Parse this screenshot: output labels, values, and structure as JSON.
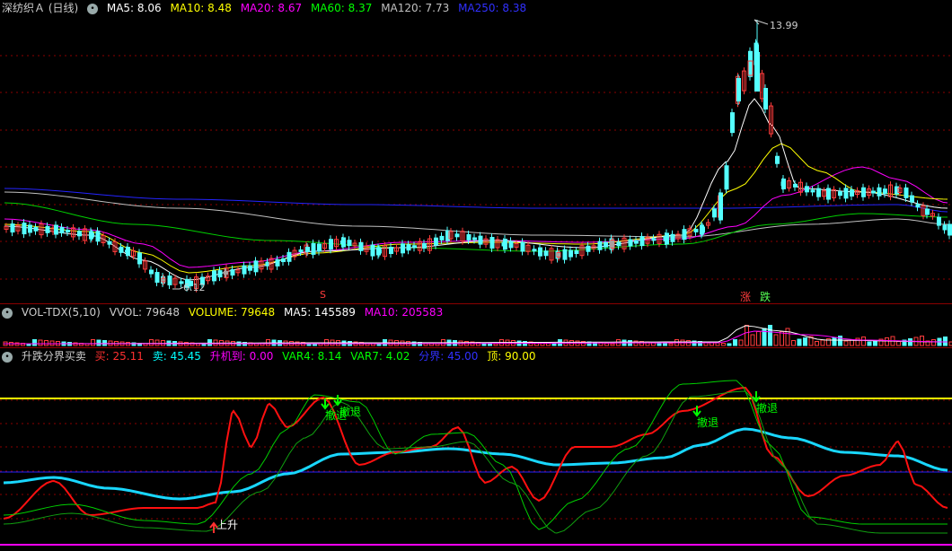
{
  "main_chart": {
    "title": "深纺织Ａ (日线)",
    "indicators": [
      {
        "label": "MA5: 8.06",
        "color": "#ffffff"
      },
      {
        "label": "MA10: 8.48",
        "color": "#ffff00"
      },
      {
        "label": "MA20: 8.67",
        "color": "#ff00ff"
      },
      {
        "label": "MA60: 8.37",
        "color": "#00ff00"
      },
      {
        "label": "MA120: 7.73",
        "color": "#c0c0c0"
      },
      {
        "label": "MA250: 8.38",
        "color": "#0000ff"
      }
    ],
    "high_label": "13.99",
    "low_label": "6.12",
    "markers": {
      "s": "S",
      "up": "涨",
      "down": "跌"
    }
  },
  "volume_chart": {
    "title": "VOL-TDX(5,10)",
    "indicators": [
      {
        "label": "VVOL: 79648",
        "color": "#cccccc"
      },
      {
        "label": "VOLUME: 79648",
        "color": "#ffff00"
      },
      {
        "label": "MA5: 145589",
        "color": "#ffffff"
      },
      {
        "label": "MA10: 205583",
        "color": "#ff00ff"
      }
    ]
  },
  "signal_chart": {
    "title": "升跌分界买卖",
    "indicators": [
      {
        "label": "买: 25.11",
        "color": "#ff3030"
      },
      {
        "label": "卖: 45.45",
        "color": "#00ffff"
      },
      {
        "label": "升机到: 0.00",
        "color": "#ff00ff"
      },
      {
        "label": "VAR4: 8.14",
        "color": "#00ff00"
      },
      {
        "label": "VAR7: 4.02",
        "color": "#00ff00"
      },
      {
        "label": "分界: 45.00",
        "color": "#0000ff"
      },
      {
        "label": "顶: 90.00",
        "color": "#ffff00"
      }
    ],
    "signals": {
      "rise": "上升",
      "exit": "撤退"
    }
  },
  "colors": {
    "up": "#ff3c3c",
    "down": "#54ffff",
    "grid": "#8b0000"
  }
}
